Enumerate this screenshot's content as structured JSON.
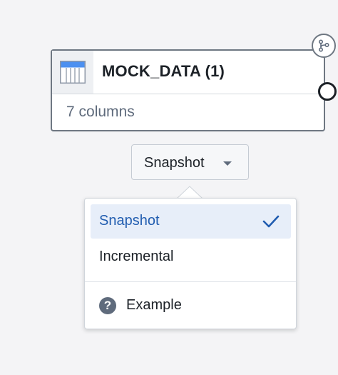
{
  "node": {
    "title": "MOCK_DATA (1)",
    "subtitle": "7 columns",
    "icon": "table-icon"
  },
  "mode_select": {
    "value": "Snapshot",
    "caret_icon": "caret-down-icon"
  },
  "menu": {
    "items": [
      {
        "label": "Snapshot",
        "selected": true,
        "icon": "check-icon"
      },
      {
        "label": "Incremental",
        "selected": false
      }
    ],
    "footer_item": {
      "label": "Example",
      "icon": "help-icon",
      "icon_glyph": "?"
    }
  },
  "colors": {
    "selected_text": "#215db0",
    "selected_bg": "#e7eef9",
    "table_icon_header": "#4c90f0",
    "border": "#6e7782"
  }
}
